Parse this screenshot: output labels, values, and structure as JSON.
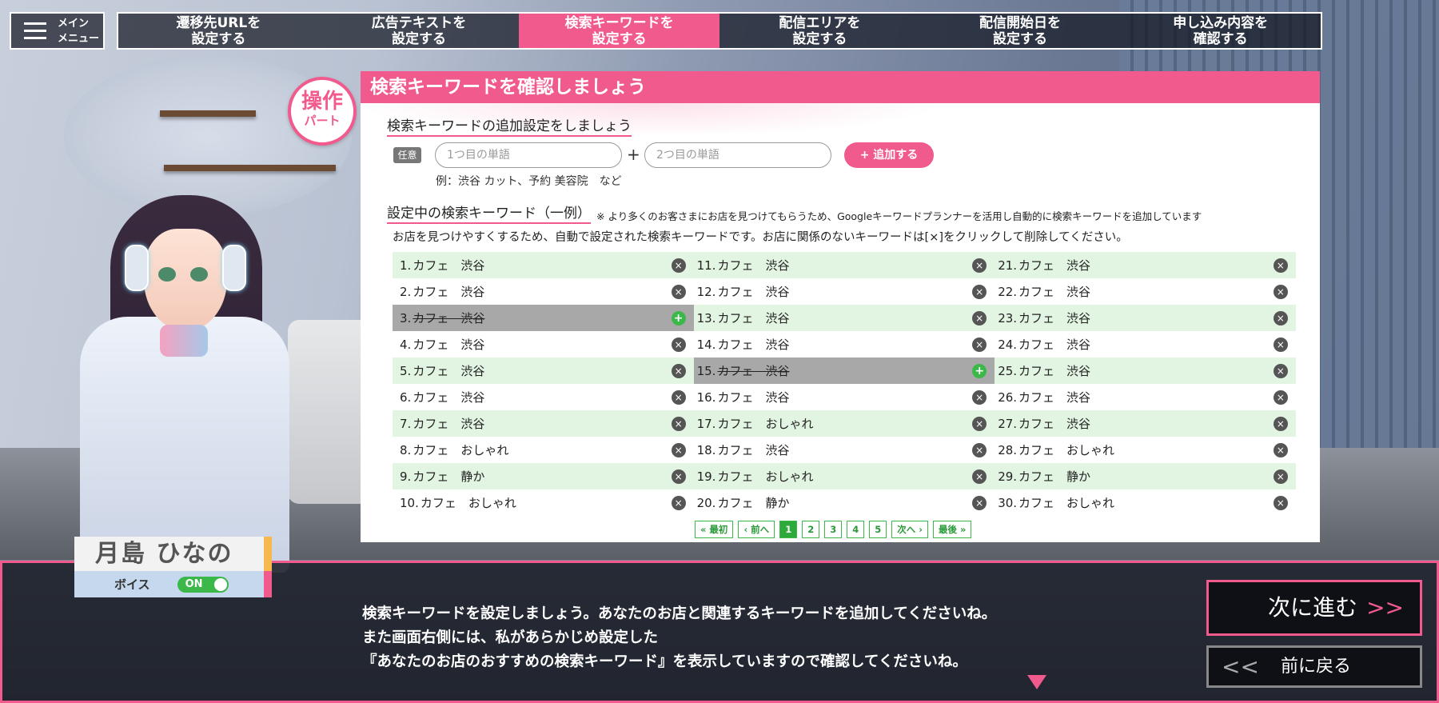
{
  "menu": {
    "label": "メイン\nメニュー"
  },
  "steps": [
    {
      "label": "遷移先URLを\n設定する"
    },
    {
      "label": "広告テキストを\n設定する"
    },
    {
      "label": "検索キーワードを\n設定する"
    },
    {
      "label": "配信エリアを\n設定する"
    },
    {
      "label": "配信開始日を\n設定する"
    },
    {
      "label": "申し込み内容を\n確認する"
    }
  ],
  "active_step": 2,
  "badge": {
    "big": "操作",
    "small": "パート"
  },
  "panel": {
    "title": "検索キーワードを確認しましょう",
    "add_section": {
      "title": "検索キーワードの追加設定をしましょう",
      "optional_tag": "任意",
      "input1_placeholder": "1つ目の単語",
      "input2_placeholder": "2つ目の単語",
      "plus": "+",
      "add_button": "+ 追加する",
      "example": "例：渋谷 カット、予約 美容院　など"
    },
    "list_section": {
      "title": "設定中の検索キーワード（一例）",
      "note": "※ より多くのお客さまにお店を見つけてもらうため、Googleキーワードプランナーを活用し自動的に検索キーワードを追加しています",
      "description": "お店を見つけやすくするため、自動で設定された検索キーワードです。お店に関係のないキーワードは[×]をクリックして削除してください。"
    },
    "columns": [
      [
        {
          "num": "1.",
          "text": "カフェ　渋谷",
          "removed": false
        },
        {
          "num": "2.",
          "text": "カフェ　渋谷",
          "removed": false
        },
        {
          "num": "3.",
          "text": "カフェ　渋谷",
          "removed": true
        },
        {
          "num": "4.",
          "text": "カフェ　渋谷",
          "removed": false
        },
        {
          "num": "5.",
          "text": "カフェ　渋谷",
          "removed": false
        },
        {
          "num": "6.",
          "text": "カフェ　渋谷",
          "removed": false
        },
        {
          "num": "7.",
          "text": "カフェ　渋谷",
          "removed": false
        },
        {
          "num": "8.",
          "text": "カフェ　おしゃれ",
          "removed": false
        },
        {
          "num": "9.",
          "text": "カフェ　静か",
          "removed": false
        },
        {
          "num": "10.",
          "text": "カフェ　おしゃれ",
          "removed": false
        }
      ],
      [
        {
          "num": "11.",
          "text": "カフェ　渋谷",
          "removed": false
        },
        {
          "num": "12.",
          "text": "カフェ　渋谷",
          "removed": false
        },
        {
          "num": "13.",
          "text": "カフェ　渋谷",
          "removed": false
        },
        {
          "num": "14.",
          "text": "カフェ　渋谷",
          "removed": false
        },
        {
          "num": "15.",
          "text": "カフェ　渋谷",
          "removed": true
        },
        {
          "num": "16.",
          "text": "カフェ　渋谷",
          "removed": false
        },
        {
          "num": "17.",
          "text": "カフェ　おしゃれ",
          "removed": false
        },
        {
          "num": "18.",
          "text": "カフェ　渋谷",
          "removed": false
        },
        {
          "num": "19.",
          "text": "カフェ　おしゃれ",
          "removed": false
        },
        {
          "num": "20.",
          "text": "カフェ　静か",
          "removed": false
        }
      ],
      [
        {
          "num": "21.",
          "text": "カフェ　渋谷",
          "removed": false
        },
        {
          "num": "22.",
          "text": "カフェ　渋谷",
          "removed": false
        },
        {
          "num": "23.",
          "text": "カフェ　渋谷",
          "removed": false
        },
        {
          "num": "24.",
          "text": "カフェ　渋谷",
          "removed": false
        },
        {
          "num": "25.",
          "text": "カフェ　渋谷",
          "removed": false
        },
        {
          "num": "26.",
          "text": "カフェ　渋谷",
          "removed": false
        },
        {
          "num": "27.",
          "text": "カフェ　渋谷",
          "removed": false
        },
        {
          "num": "28.",
          "text": "カフェ　おしゃれ",
          "removed": false
        },
        {
          "num": "29.",
          "text": "カフェ　静か",
          "removed": false
        },
        {
          "num": "30.",
          "text": "カフェ　おしゃれ",
          "removed": false
        }
      ]
    ],
    "remove_icon": "×",
    "restore_icon": "+",
    "pager": {
      "first": "« 最初",
      "prev": "‹ 前へ",
      "pages": [
        "1",
        "2",
        "3",
        "4",
        "5"
      ],
      "current": "1",
      "next": "次へ ›",
      "last": "最後 »"
    }
  },
  "character": {
    "name": "月島 ひなの",
    "voice_label": "ボイス",
    "voice_state": "ON"
  },
  "dialog": {
    "lines": [
      "検索キーワードを設定しましょう。あなたのお店と関連するキーワードを追加してくださいね。",
      "また画面右側には、私があらかじめ設定した",
      "『あなたのお店のおすすめの検索キーワード』を表示していますので確認してくださいね。"
    ],
    "next_button": "次に進む",
    "next_chevron": ">>",
    "back_button": "前に戻る",
    "back_chevron": "<<"
  },
  "colors": {
    "accent": "#f05a8c",
    "green": "#3cb84a",
    "row_shade": "#e2f4e2",
    "removed_row": "#a8a8a8"
  }
}
